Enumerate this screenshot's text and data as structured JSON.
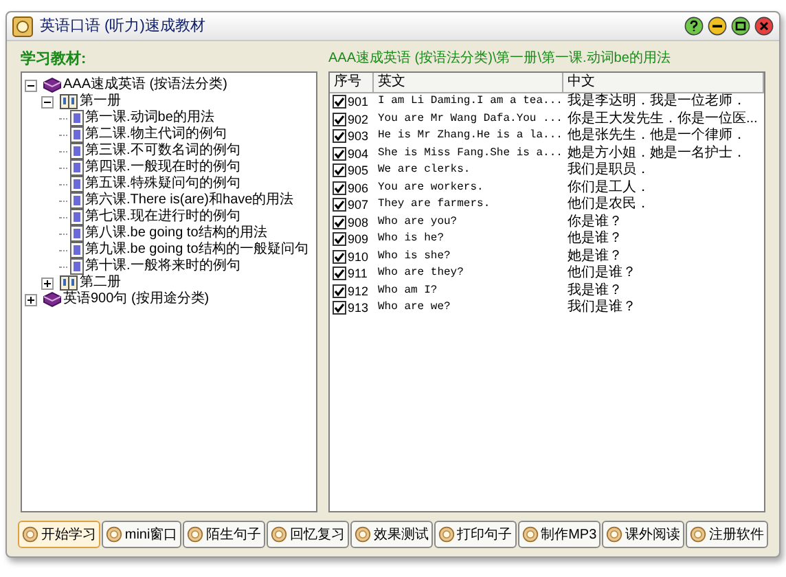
{
  "window": {
    "title": "英语口语 (听力)速成教材"
  },
  "left_panel": {
    "label": "学习教材:",
    "tree": [
      {
        "kind": "book",
        "label": "AAA速成英语 (按语法分类)",
        "expanded": true,
        "children": [
          {
            "kind": "volume",
            "label": "第一册",
            "expanded": true,
            "children": [
              {
                "kind": "lesson",
                "label": "第一课.动词be的用法"
              },
              {
                "kind": "lesson",
                "label": "第二课.物主代词的例句"
              },
              {
                "kind": "lesson",
                "label": "第三课.不可数名词的例句"
              },
              {
                "kind": "lesson",
                "label": "第四课.一般现在时的例句"
              },
              {
                "kind": "lesson",
                "label": "第五课.特殊疑问句的例句"
              },
              {
                "kind": "lesson",
                "label": "第六课.There is(are)和have的用法"
              },
              {
                "kind": "lesson",
                "label": "第七课.现在进行时的例句"
              },
              {
                "kind": "lesson",
                "label": "第八课.be going to结构的用法"
              },
              {
                "kind": "lesson",
                "label": "第九课.be going to结构的一般疑问句"
              },
              {
                "kind": "lesson",
                "label": "第十课.一般将来时的例句"
              }
            ]
          },
          {
            "kind": "volume",
            "label": "第二册",
            "expanded": false
          }
        ]
      },
      {
        "kind": "book",
        "label": "英语900句 (按用途分类)",
        "expanded": false
      }
    ]
  },
  "right_panel": {
    "path": "AAA速成英语 (按语法分类)\\第一册\\第一课.动词be的用法",
    "table": {
      "columns": [
        "序号",
        "英文",
        "中文"
      ],
      "rows": [
        {
          "checked": true,
          "no": "901",
          "english": "I am Li Daming.I am a tea...",
          "chinese": "我是李达明．我是一位老师．"
        },
        {
          "checked": true,
          "no": "902",
          "english": "You are Mr Wang Dafa.You ...",
          "chinese": "你是王大发先生．你是一位医..."
        },
        {
          "checked": true,
          "no": "903",
          "english": "He is Mr Zhang.He is a la...",
          "chinese": "他是张先生．他是一个律师．"
        },
        {
          "checked": true,
          "no": "904",
          "english": "She is Miss Fang.She is a...",
          "chinese": "她是方小姐．她是一名护士．"
        },
        {
          "checked": true,
          "no": "905",
          "english": "We are clerks.",
          "chinese": "我们是职员．"
        },
        {
          "checked": true,
          "no": "906",
          "english": "You are workers.",
          "chinese": "你们是工人．"
        },
        {
          "checked": true,
          "no": "907",
          "english": "They are farmers.",
          "chinese": "他们是农民．"
        },
        {
          "checked": true,
          "no": "908",
          "english": "Who are you?",
          "chinese": "你是谁？"
        },
        {
          "checked": true,
          "no": "909",
          "english": "Who is he?",
          "chinese": "他是谁？"
        },
        {
          "checked": true,
          "no": "910",
          "english": "Who is she?",
          "chinese": "她是谁？"
        },
        {
          "checked": true,
          "no": "911",
          "english": "Who are they?",
          "chinese": "他们是谁？"
        },
        {
          "checked": true,
          "no": "912",
          "english": "Who am I?",
          "chinese": "我是谁？"
        },
        {
          "checked": true,
          "no": "913",
          "english": "Who are we?",
          "chinese": "我们是谁？"
        }
      ]
    }
  },
  "buttons": [
    {
      "label": "开始学习",
      "selected": true
    },
    {
      "label": "mini窗口",
      "selected": false
    },
    {
      "label": "陌生句子",
      "selected": false
    },
    {
      "label": "回忆复习",
      "selected": false
    },
    {
      "label": "效果测试",
      "selected": false
    },
    {
      "label": "打印句子",
      "selected": false
    },
    {
      "label": "制作MP3",
      "selected": false
    },
    {
      "label": "课外阅读",
      "selected": false
    },
    {
      "label": "注册软件",
      "selected": false
    }
  ]
}
